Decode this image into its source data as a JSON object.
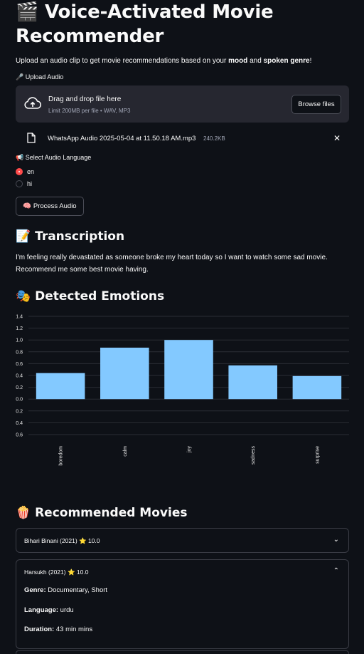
{
  "header": {
    "icon": "🎬",
    "title_line1": "Voice-Activated Movie",
    "title_line2": "Recommender"
  },
  "intro": {
    "prefix": "Upload an audio clip to get movie recommendations based on your ",
    "bold1": "mood",
    "middle": " and ",
    "bold2": "spoken genre",
    "suffix": "!"
  },
  "upload": {
    "label": "🎤 Upload Audio",
    "dropzone_title": "Drag and drop file here",
    "dropzone_limit": "Limit 200MB per file • WAV, MP3",
    "browse_label": "Browse files",
    "file_name": "WhatsApp Audio 2025-05-04 at 11.50.18 AM.mp3",
    "file_size": "240.2KB",
    "close_glyph": "✕"
  },
  "language": {
    "label": "📢 Select Audio Language",
    "options": [
      "en",
      "hi"
    ],
    "selected": "en"
  },
  "process_button": "🧠 Process Audio",
  "transcription": {
    "heading": "📝 Transcription",
    "text": "I'm feeling really devastated as someone broke my heart today so I want to watch some sad movie. Recommend me some best movie having."
  },
  "emotions": {
    "heading": "🎭 Detected Emotions"
  },
  "chart_data": {
    "type": "bar",
    "categories": [
      "boredom",
      "calm",
      "joy",
      "sadness",
      "surprise"
    ],
    "values": [
      0.44,
      0.87,
      1.0,
      0.57,
      0.39
    ],
    "ylim": [
      -0.6,
      1.4
    ],
    "yticks": [
      1.4,
      1.2,
      1.0,
      0.8,
      0.6,
      0.4,
      0.2,
      0.0,
      -0.2,
      -0.4,
      -0.6
    ],
    "ytick_labels": [
      "1.4",
      "1.2",
      "1.0",
      "0.8",
      "0.6",
      "0.4",
      "0.2",
      "0.0",
      "0.2",
      "0.4",
      "0.6"
    ],
    "bar_color": "#83c9ff",
    "grid": true
  },
  "movies": {
    "heading": "🍿 Recommended Movies",
    "items": [
      {
        "title": "Bihari Binani (2021) ⭐ 10.0",
        "expanded": false
      },
      {
        "title": "Harsukh (2021) ⭐ 10.0",
        "expanded": true,
        "genre_label": "Genre:",
        "genre": "Documentary, Short",
        "language_label": "Language:",
        "language": "urdu",
        "duration_label": "Duration:",
        "duration": "43 min mins"
      }
    ]
  }
}
